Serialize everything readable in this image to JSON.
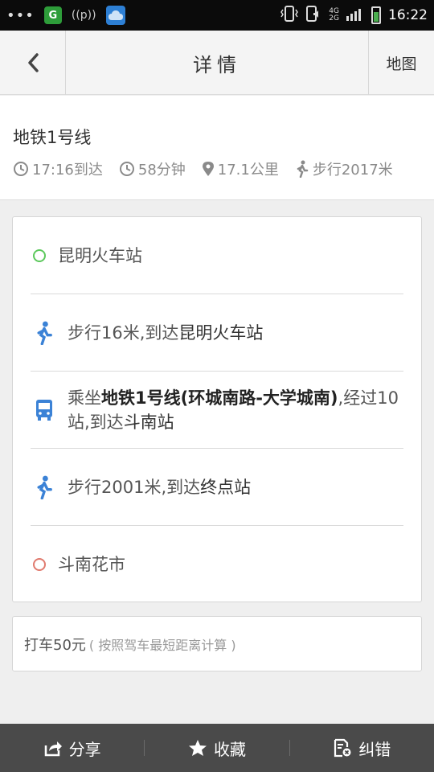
{
  "status_bar": {
    "dots": "•••",
    "app1_label": "G",
    "wifi_label": "((p))",
    "network_top": "4G",
    "network_bottom": "2G",
    "time": "16:22"
  },
  "header": {
    "title": "详情",
    "map_label": "地图"
  },
  "summary": {
    "route_name": "地铁1号线",
    "arrive": "17:16到达",
    "duration": "58分钟",
    "distance": "17.1公里",
    "walk": "步行2017米"
  },
  "steps": [
    {
      "type": "start",
      "text": "昆明火车站"
    },
    {
      "type": "walk",
      "prefix": "步行16米,到达",
      "bold": "昆明火车站",
      "suffix": ""
    },
    {
      "type": "bus",
      "prefix": "乘坐",
      "bold": "地铁1号线(环城南路-大学城南)",
      "suffix": ",经过10站,到达",
      "bold2": "斗南站"
    },
    {
      "type": "walk",
      "prefix": "步行2001米,到达",
      "bold": "终点站",
      "suffix": ""
    },
    {
      "type": "end",
      "text": "斗南花市"
    }
  ],
  "taxi": {
    "main": "打车50元",
    "note": "( 按照驾车最短距离计算 )"
  },
  "bottom_bar": {
    "share": "分享",
    "favorite": "收藏",
    "report": "纠错"
  },
  "colors": {
    "start_circle": "#5cc85c",
    "end_circle": "#e07a6e",
    "icon_blue": "#3b82d6"
  }
}
